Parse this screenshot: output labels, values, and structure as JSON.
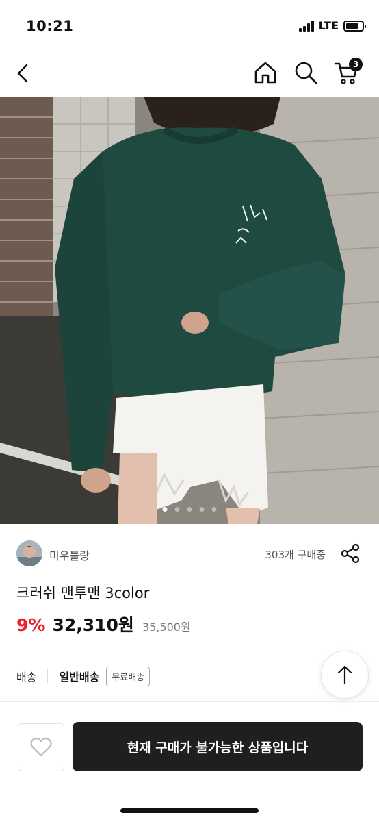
{
  "status_bar": {
    "time": "10:21",
    "network": "LTE",
    "battery_level": 0.8,
    "icons": [
      "signal-icon",
      "battery-icon"
    ]
  },
  "header": {
    "icons": [
      "back-chevron-icon",
      "home-icon",
      "search-icon",
      "cart-icon"
    ],
    "cart_count": "3"
  },
  "gallery": {
    "image_subject": "product-photo-green-sweatshirt",
    "page_count": 5,
    "active_index": 0
  },
  "seller": {
    "name": "미우블랑",
    "purchase_count": "303개 구매중",
    "share_icon": "share-icon"
  },
  "product": {
    "title": "크러쉬 맨투맨 3color",
    "discount": "9%",
    "price": "32,310원",
    "original_price": "35,500원"
  },
  "delivery": {
    "label": "배송",
    "type": "일반배송",
    "badge": "무료배송"
  },
  "scroll_top": {
    "icon": "arrow-up-icon"
  },
  "bottom_bar": {
    "like_icon": "heart-icon",
    "buy_label": "현재 구매가 불가능한 상품입니다"
  },
  "colors": {
    "discount": "#e8232a",
    "buy_button": "#1f1f1f",
    "sweatshirt": "#1f4a40"
  }
}
